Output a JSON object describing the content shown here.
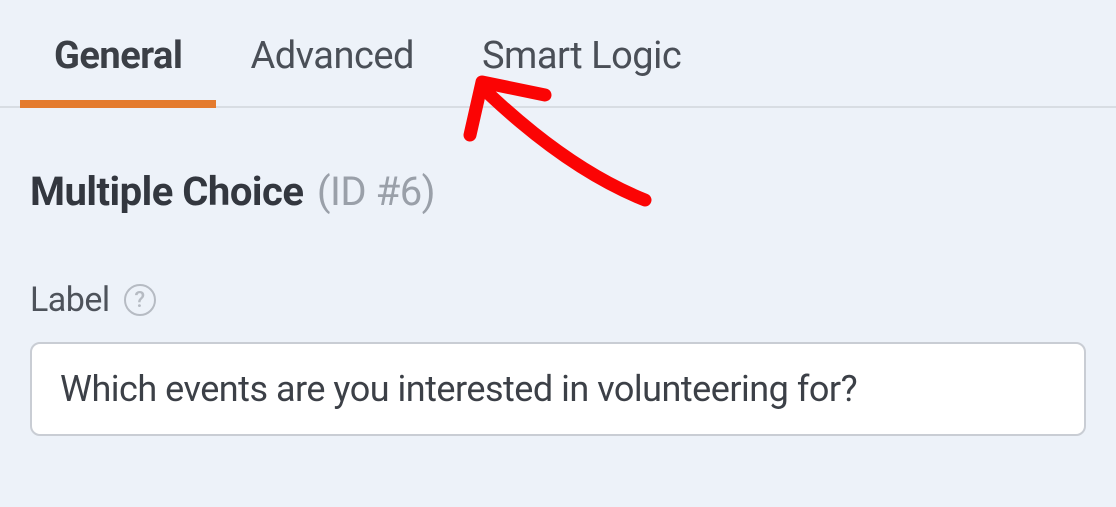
{
  "tabs": {
    "general": "General",
    "advanced": "Advanced",
    "smartLogic": "Smart Logic"
  },
  "section": {
    "title": "Multiple Choice",
    "id": "(ID #6)"
  },
  "field": {
    "label": "Label",
    "value": "Which events are you interested in volunteering for?"
  }
}
